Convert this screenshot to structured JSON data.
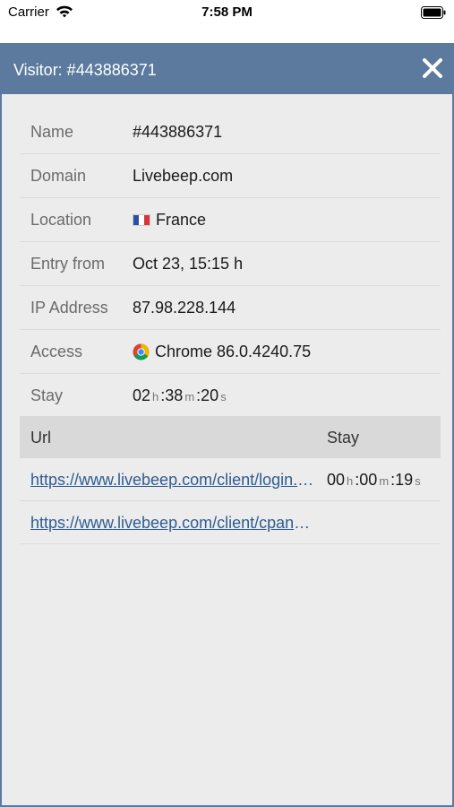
{
  "status_bar": {
    "carrier": "Carrier",
    "time": "7:58 PM"
  },
  "header": {
    "title": "Visitor: #443886371",
    "close_icon": "close-icon"
  },
  "details": {
    "name_label": "Name",
    "name_value": "#443886371",
    "domain_label": "Domain",
    "domain_value": "Livebeep.com",
    "location_label": "Location",
    "location_value": "France",
    "entry_label": "Entry from",
    "entry_value": "Oct 23, 15:15 h",
    "ip_label": "IP Address",
    "ip_value": "87.98.228.144",
    "access_label": "Access",
    "access_value": "Chrome 86.0.4240.75",
    "stay_label": "Stay",
    "stay_h": "02",
    "stay_m": "38",
    "stay_s": "20"
  },
  "units": {
    "h": "h",
    "m": "m",
    "s": "s",
    "sep": ":"
  },
  "url_table": {
    "col_url": "Url",
    "col_stay": "Stay",
    "rows": [
      {
        "url": "https://www.livebeep.com/client/login.php",
        "h": "00",
        "m": "00",
        "s": "19"
      },
      {
        "url": "https://www.livebeep.com/client/cpanel.php"
      }
    ]
  },
  "colors": {
    "header": "#5b7a9d",
    "panel_bg": "#ececec",
    "link": "#2d5d93",
    "flag_blue": "#2b4fa3",
    "flag_white": "#ffffff",
    "flag_red": "#d9343c"
  }
}
